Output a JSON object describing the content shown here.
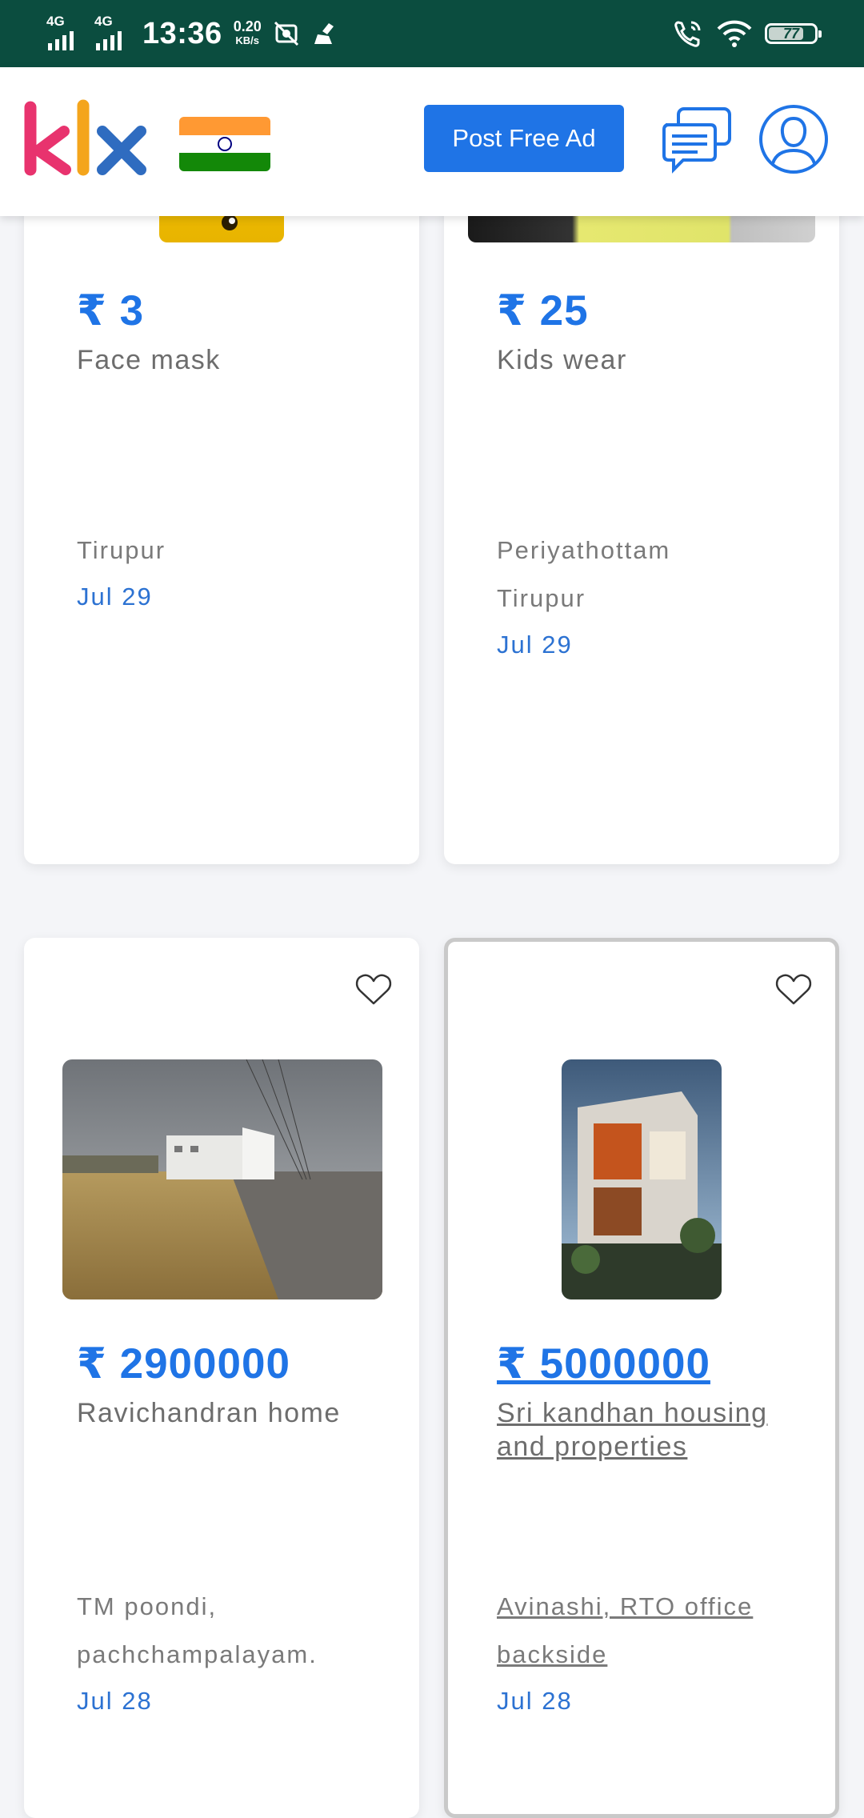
{
  "status_bar": {
    "signal1_label": "4G",
    "signal2_label": "4G",
    "time": "13:36",
    "speed_value": "0.20",
    "speed_unit": "KB/s",
    "battery": "77",
    "battery_level": 0.77
  },
  "header": {
    "logo": "klx",
    "flag": "india-flag-icon",
    "post_button": "Post Free Ad",
    "chat_icon": "chat-icon",
    "profile_icon": "profile-icon"
  },
  "listings": [
    {
      "price": "₹ 3",
      "title": "Face mask",
      "location_lines": [
        "Tirupur"
      ],
      "date": "Jul 29",
      "favorite": false
    },
    {
      "price": "₹ 25",
      "title": "Kids wear",
      "location_lines": [
        "Periyathottam",
        "Tirupur"
      ],
      "date": "Jul 29",
      "favorite": false
    },
    {
      "price": "₹ 2900000",
      "title": "Ravichandran home",
      "location_lines": [
        "TM poondi,",
        "pachchampalayam."
      ],
      "date": "Jul 28",
      "favorite": false
    },
    {
      "price": "₹ 5000000",
      "title": "Sri kandhan housing and properties",
      "location_lines": [
        "Avinashi, RTO office",
        "backside"
      ],
      "date": "Jul 28",
      "favorite": false
    }
  ],
  "colors": {
    "status_bar": "#0b4d3f",
    "accent": "#1f74e6",
    "date": "#2c72d2",
    "text_muted": "#6d6d6d"
  }
}
